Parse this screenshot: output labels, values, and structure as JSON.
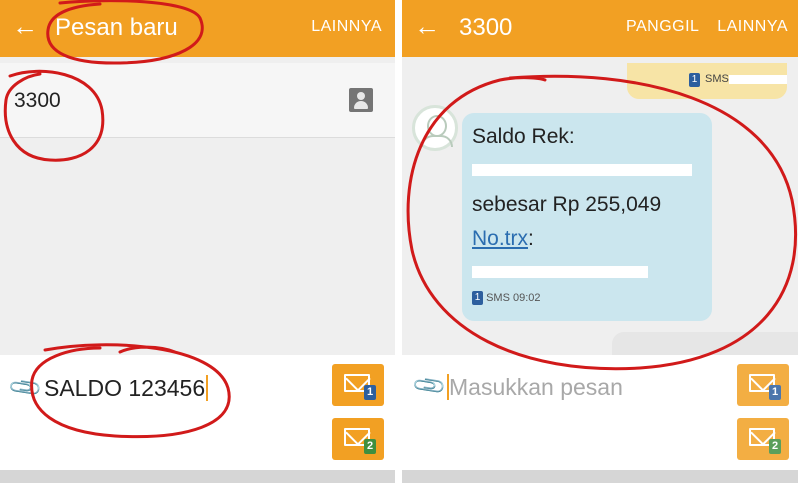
{
  "left_screen": {
    "header": {
      "back_icon": "arrow-left-icon",
      "title": "Pesan baru",
      "menu_label": "LAINNYA"
    },
    "recipient": {
      "value": "3300",
      "contact_icon": "contact-icon"
    },
    "compose": {
      "attach_icon": "paperclip-icon",
      "message": "SALDO 123456",
      "send_sim1": {
        "icon": "send-sim-icon",
        "sim": "1"
      },
      "send_sim2": {
        "icon": "send-sim-icon",
        "sim": "2"
      }
    }
  },
  "right_screen": {
    "header": {
      "back_icon": "arrow-left-icon",
      "title": "3300",
      "call_label": "PANGGIL",
      "menu_label": "LAINNYA"
    },
    "sent_top": {
      "meta_partial": "SMS",
      "badge": "1"
    },
    "received": {
      "line1": "Saldo Rek:",
      "line2": "",
      "line3": "sebesar Rp 255,049",
      "line4_link": "No.trx",
      "line4_suffix": ":",
      "line5": "",
      "badge": "1",
      "meta": "SMS 09:02"
    },
    "sent_bottom": {
      "peek": ""
    },
    "compose": {
      "attach_icon": "paperclip-icon",
      "placeholder": "Masukkan pesan",
      "send_sim1": {
        "icon": "send-sim-icon",
        "sim": "1"
      },
      "send_sim2": {
        "icon": "send-sim-icon",
        "sim": "2"
      }
    }
  },
  "colors": {
    "appbar": "#f2a023",
    "incoming_bubble": "#cbe6ee",
    "outgoing_bubble": "#f7e4a6",
    "annotation": "#d11a1a"
  }
}
